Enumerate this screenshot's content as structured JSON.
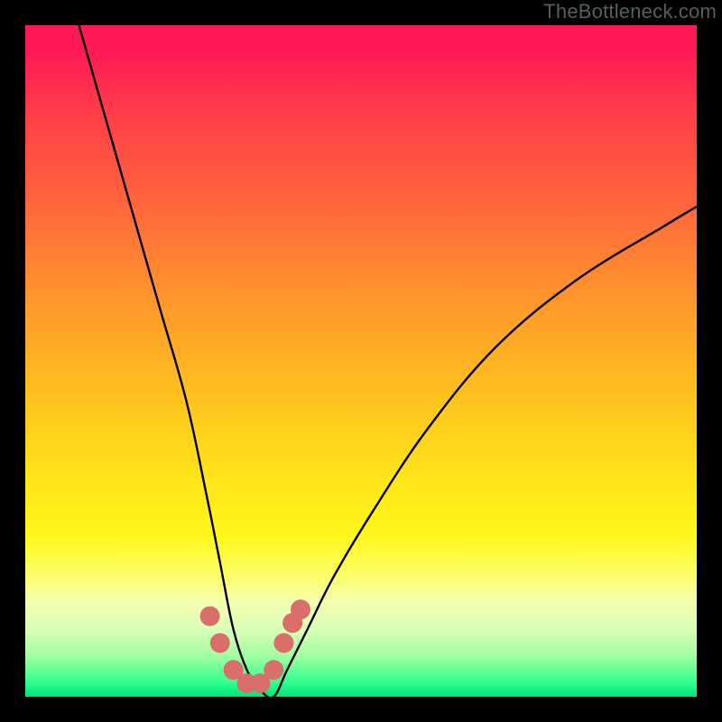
{
  "watermark": "TheBottleneck.com",
  "chart_data": {
    "type": "line",
    "title": "",
    "xlabel": "",
    "ylabel": "",
    "xlim": [
      0,
      100
    ],
    "ylim": [
      0,
      100
    ],
    "grid": false,
    "legend": false,
    "series": [
      {
        "name": "bottleneck-curve",
        "x": [
          8,
          12,
          16,
          20,
          24,
          27,
          29,
          31,
          33,
          35,
          37,
          39,
          42,
          46,
          52,
          60,
          70,
          82,
          95,
          100
        ],
        "y": [
          100,
          86,
          72,
          58,
          44,
          30,
          20,
          10,
          4,
          1,
          0,
          4,
          10,
          18,
          28,
          40,
          52,
          62,
          70,
          73
        ]
      },
      {
        "name": "trough-dots",
        "type": "scatter",
        "x": [
          27.5,
          29.0,
          31.0,
          33.0,
          35.0,
          37.0,
          38.5,
          39.8,
          41.0
        ],
        "y": [
          12,
          8,
          4,
          2,
          2,
          4,
          8,
          11,
          13
        ]
      }
    ],
    "background_gradient_stops": [
      {
        "pos": 0,
        "color": "#ff1a55"
      },
      {
        "pos": 4,
        "color": "#ff1a55"
      },
      {
        "pos": 12,
        "color": "#ff3a4a"
      },
      {
        "pos": 28,
        "color": "#ff6a3a"
      },
      {
        "pos": 42,
        "color": "#ff9a2a"
      },
      {
        "pos": 56,
        "color": "#ffc41e"
      },
      {
        "pos": 68,
        "color": "#ffe61a"
      },
      {
        "pos": 76,
        "color": "#fff71a"
      },
      {
        "pos": 82,
        "color": "#fcff6a"
      },
      {
        "pos": 86,
        "color": "#f5ffb0"
      },
      {
        "pos": 90,
        "color": "#d8ffb8"
      },
      {
        "pos": 94,
        "color": "#9effa0"
      },
      {
        "pos": 98,
        "color": "#2eff90"
      },
      {
        "pos": 100,
        "color": "#00e37a"
      }
    ],
    "dot_color": "#d96e6a",
    "curve_color": "#000000"
  }
}
